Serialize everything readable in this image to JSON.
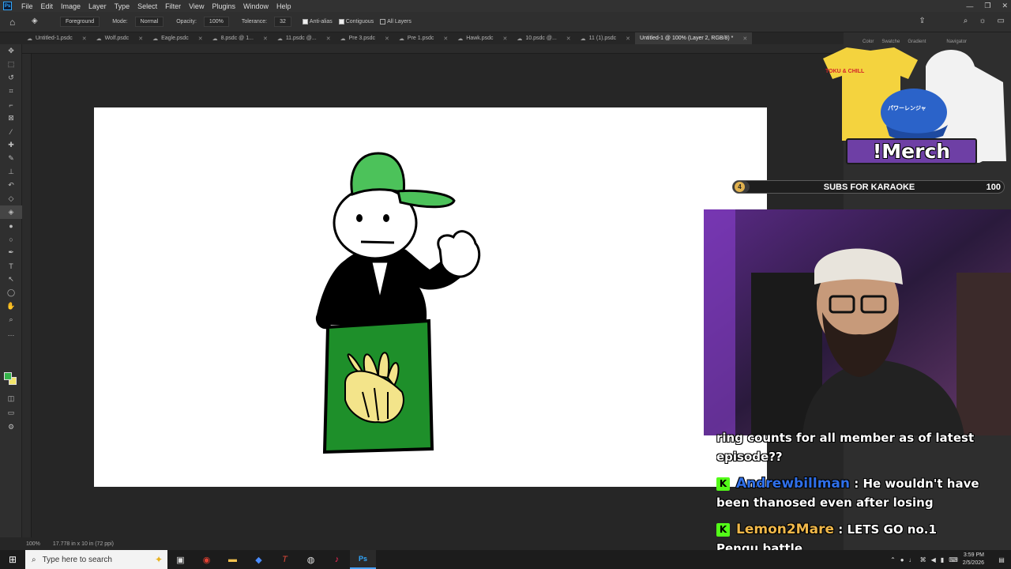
{
  "menubar": {
    "logo": "Ps",
    "items": [
      "File",
      "Edit",
      "Image",
      "Layer",
      "Type",
      "Select",
      "Filter",
      "View",
      "Plugins",
      "Window",
      "Help"
    ]
  },
  "options": {
    "source": "Foreground",
    "mode_label": "Mode:",
    "mode_value": "Normal",
    "opacity_label": "Opacity:",
    "opacity_value": "100%",
    "tolerance_label": "Tolerance:",
    "tolerance_value": "32",
    "antialias_label": "Anti-alias",
    "contiguous_label": "Contiguous",
    "all_layers_label": "All Layers"
  },
  "tabs": [
    {
      "label": "Untitled-1.psdc"
    },
    {
      "label": "Wolf.psdc"
    },
    {
      "label": "Eagle.psdc"
    },
    {
      "label": "8.psdc @ 1..."
    },
    {
      "label": "11.psdc @..."
    },
    {
      "label": "Pre 3.psdc"
    },
    {
      "label": "Pre 1.psdc"
    },
    {
      "label": "Hawk.psdc"
    },
    {
      "label": "10.psdc @..."
    },
    {
      "label": "11 (1).psdc"
    },
    {
      "label": "Untitled-1 @ 100% (Layer 2, RGB/8) *"
    }
  ],
  "panels": {
    "tabs": [
      "Color",
      "Swatche",
      "Gradient",
      "Navigator"
    ]
  },
  "status": {
    "zoom": "100%",
    "doc_info": "17.778 in x 10 in (72 ppi)"
  },
  "overlay": {
    "merch_label": "!Merch",
    "merch_shirt_text": "TOKU & CHILL",
    "merch_hat_text": "パワーレンジャ",
    "goal_current": "4",
    "goal_label": "SUBS FOR KARAOKE",
    "goal_target": "100",
    "goal_progress": 0.04
  },
  "chat": {
    "line1": "ring counts for all member as of latest",
    "line2": "episode??",
    "msg2_user": "Andrewbillman",
    "msg2_text": " : He wouldn't have",
    "msg2_cont": "been thanosed even after losing",
    "msg3_user": "Lemon2Mare",
    "msg3_text": " : LETS GO no.1",
    "msg3_cont": "Pengu battle",
    "badge": "K"
  },
  "taskbar": {
    "search_placeholder": "Type here to search",
    "time": "3:59 PM",
    "date": "2/5/2026"
  },
  "colors": {
    "foreground": "#34b34a",
    "background": "#f2e46a",
    "podium_green": "#1e8f2a",
    "cap_green": "#4cc25a",
    "emblem_yellow": "#f3e48a"
  }
}
